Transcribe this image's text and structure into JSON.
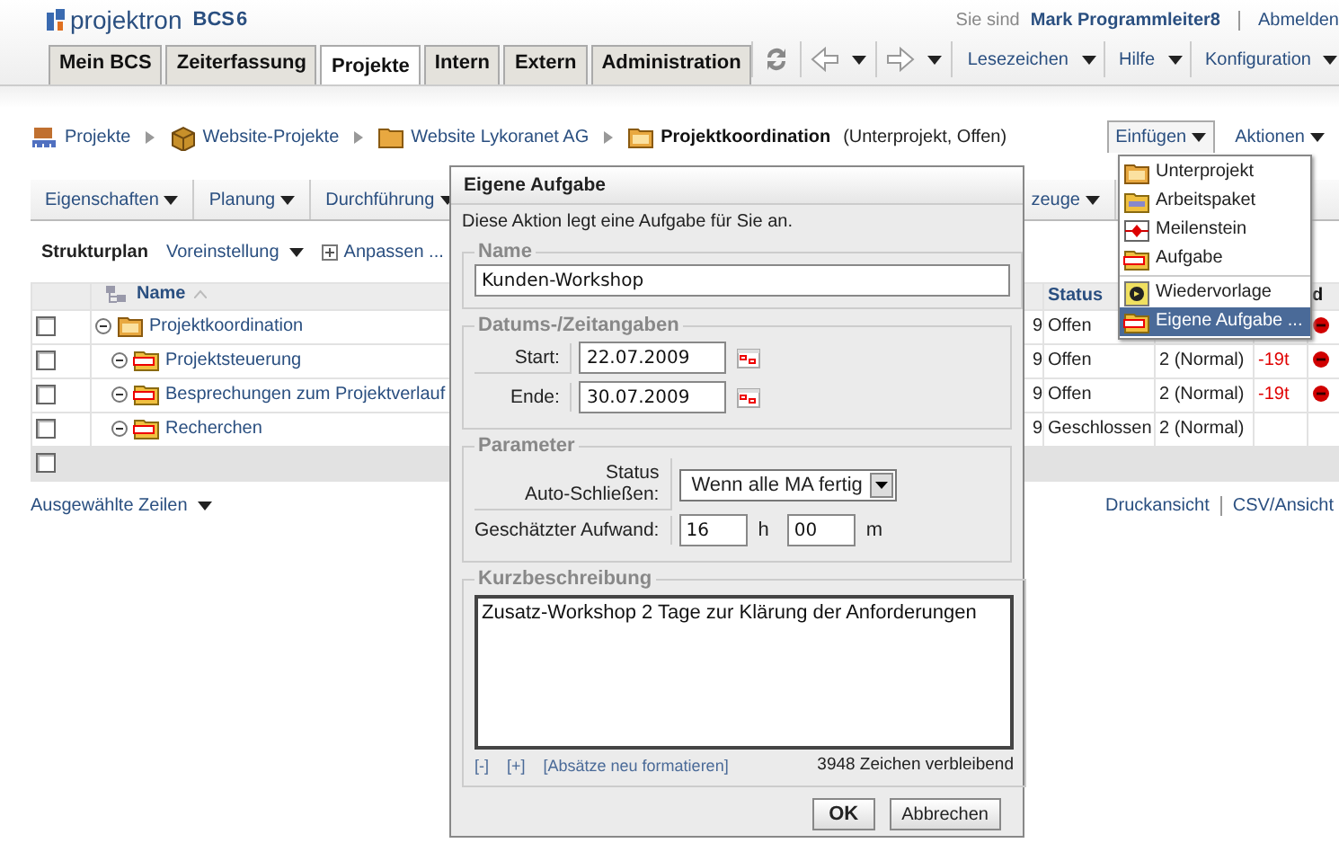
{
  "app": {
    "logo": "projektron",
    "logo_product": "BCS",
    "logo_version": "6",
    "user_label": "Sie sind",
    "user": "Mark Programmleiter8",
    "logout": "Abmelden"
  },
  "tabs": [
    {
      "label": "Mein BCS",
      "selected": false
    },
    {
      "label": "Zeiterfassung",
      "selected": false
    },
    {
      "label": "Projekte",
      "selected": true
    },
    {
      "label": "Intern",
      "selected": false
    },
    {
      "label": "Extern",
      "selected": false
    },
    {
      "label": "Administration",
      "selected": false
    }
  ],
  "toolbar_menus": [
    "Lesezeichen",
    "Hilfe",
    "Konfiguration"
  ],
  "breadcrumb": [
    {
      "label": "Projekte",
      "kind": "portfolio"
    },
    {
      "label": "Website-Projekte",
      "kind": "box"
    },
    {
      "label": "Website Lykoranet AG",
      "kind": "folder"
    },
    {
      "label": "Projektkoordination",
      "kind": "current",
      "note": "(Unterprojekt, Offen)"
    }
  ],
  "actions": [
    {
      "label": "Einfügen",
      "expanded": true
    },
    {
      "label": "Aktionen",
      "expanded": false
    }
  ],
  "view_menus": [
    "Eigenschaften",
    "Planung",
    "Durchführung",
    "zeuge"
  ],
  "structure": {
    "title": "Strukturplan",
    "preset": "Voreinstellung",
    "customize": "Anpassen ..."
  },
  "table": {
    "columns": {
      "name": "Name",
      "status": "Status",
      "flag": "d"
    },
    "rows": [
      {
        "name": "Projektkoordination",
        "kind": "subproject",
        "checked": false,
        "expanded": true,
        "column_3": "9",
        "status": "Offen",
        "overdue": true,
        "children": [
          {
            "name": "Projektsteuerung",
            "kind": "task",
            "checked": false,
            "expanded": true,
            "column_3": "9",
            "status": "Offen",
            "priority": "2 (Normal)",
            "delay": "-19t",
            "overdue": true
          },
          {
            "name": "Besprechungen zum Projektverlauf",
            "kind": "task",
            "checked": false,
            "expanded": true,
            "column_3": "9",
            "status": "Offen",
            "priority": "2 (Normal)",
            "delay": "-19t",
            "overdue": true
          },
          {
            "name": "Recherchen",
            "kind": "task",
            "checked": false,
            "expanded": true,
            "column_3": "9",
            "status": "Geschlossen",
            "priority": "2 (Normal)",
            "overdue": false
          }
        ]
      }
    ],
    "select_all": {
      "checked": false
    }
  },
  "footer": {
    "selection": "Ausgewählte Zeilen",
    "links": [
      "Druckansicht",
      "CSV/Ansicht"
    ]
  },
  "insert_menu": {
    "groups": [
      [
        {
          "label": "Unterprojekt",
          "kind": "subproject",
          "selected": false
        },
        {
          "label": "Arbeitspaket",
          "kind": "workpackage",
          "selected": false
        },
        {
          "label": "Meilenstein",
          "kind": "milestone",
          "selected": false
        },
        {
          "label": "Aufgabe",
          "kind": "task",
          "selected": false
        }
      ],
      [
        {
          "label": "Wiedervorlage",
          "kind": "reminder",
          "selected": false
        },
        {
          "label": "Eigene Aufgabe ...",
          "kind": "task",
          "selected": true
        }
      ]
    ]
  },
  "dialog": {
    "title": "Eigene Aufgabe",
    "intro": "Diese Aktion legt eine Aufgabe für Sie an.",
    "name": {
      "legend": "Name",
      "value": "Kunden-Workshop"
    },
    "dates": {
      "legend": "Datums-/Zeitangaben",
      "start_label": "Start:",
      "start": "22.07.2009",
      "end_label": "Ende:",
      "end": "30.07.2009"
    },
    "parameters": {
      "legend": "Parameter",
      "status_label": "Status\nAuto-Schließen:",
      "status_value": "Wenn alle MA fertig",
      "effort_label": "Geschätzter Aufwand:",
      "hours": "16",
      "hours_unit": "h",
      "minutes": "00",
      "minutes_unit": "m"
    },
    "description": {
      "legend": "Kurzbeschreibung",
      "value": "Zusatz-Workshop 2 Tage zur Klärung der Anforderungen",
      "tools": [
        "[-]",
        "[+]",
        "[Absätze neu formatieren]"
      ],
      "remaining": "3948 Zeichen verbleibend"
    },
    "buttons": [
      "OK",
      "Abbrechen"
    ]
  }
}
